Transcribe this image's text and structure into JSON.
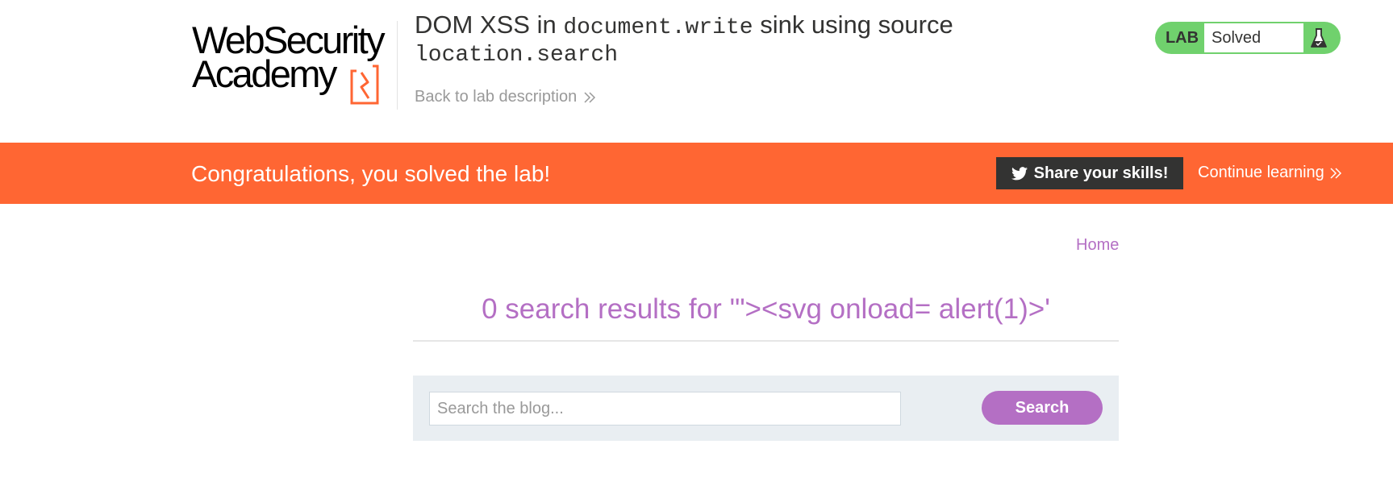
{
  "header": {
    "logo": {
      "line1": "WebSecurity",
      "line2": "Academy"
    },
    "title_prefix": "DOM XSS in ",
    "title_code_1": "document.write",
    "title_middle": " sink using source ",
    "title_code_2": "location.search",
    "back_link": "Back to lab description",
    "status": {
      "badge": "LAB",
      "text": "Solved",
      "icon": "flask-icon"
    }
  },
  "banner": {
    "message": "Congratulations, you solved the lab!",
    "share_label": "Share your skills!",
    "continue_label": "Continue learning"
  },
  "nav": {
    "home_label": "Home"
  },
  "search": {
    "results_heading": "0 search results for '\"><svg onload= alert(1)>'",
    "placeholder": "Search the blog...",
    "button_label": "Search"
  },
  "colors": {
    "accent_orange": "#ff6633",
    "accent_purple": "#b46fc4",
    "solved_green": "#70d16d",
    "dark": "#333332"
  }
}
